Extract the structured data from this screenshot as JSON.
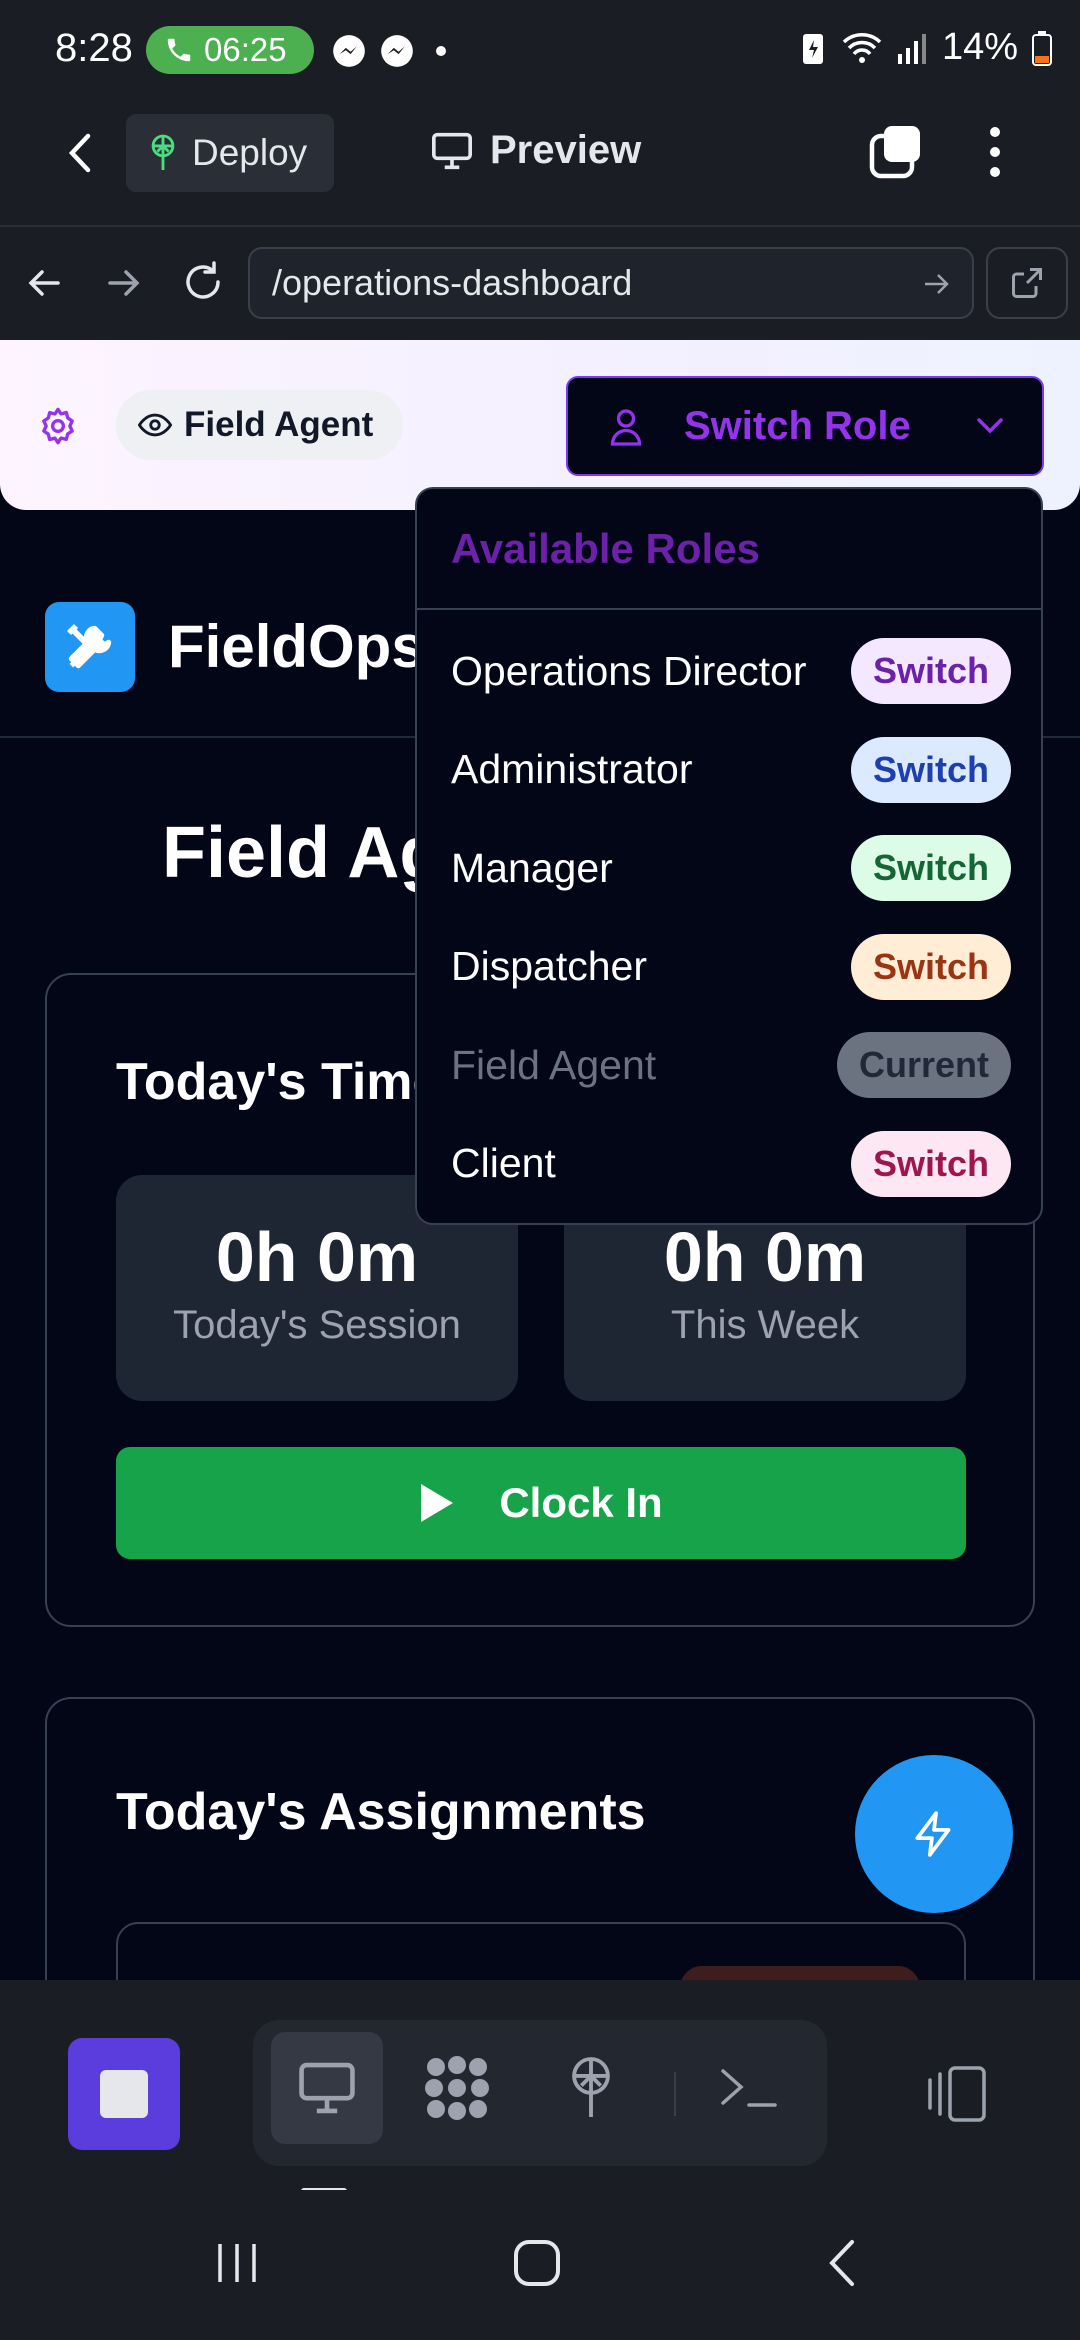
{
  "status_bar": {
    "time": "8:28",
    "call_timer": "06:25",
    "battery": "14%"
  },
  "app_header": {
    "deploy_label": "Deploy",
    "preview_label": "Preview"
  },
  "url_bar": {
    "url": "/operations-dashboard"
  },
  "role_banner": {
    "current_role": "Field Agent",
    "switch_label": "Switch Role"
  },
  "brand": {
    "name": "FieldOps"
  },
  "page": {
    "title": "Field Agent Dashboard"
  },
  "time_card": {
    "title": "Today's Time Tracking",
    "session_value": "0h 0m",
    "session_label": "Today's Session",
    "week_value": "0h 0m",
    "week_label": "This Week",
    "clock_in_label": "Clock In"
  },
  "assignments_card": {
    "title": "Today's Assignments"
  },
  "dropdown": {
    "header": "Available Roles",
    "roles": [
      {
        "name": "Operations Director",
        "badge": "Switch",
        "badge_bg": "#f3e8ff",
        "badge_fg": "#6b21a8"
      },
      {
        "name": "Administrator",
        "badge": "Switch",
        "badge_bg": "#dbeafe",
        "badge_fg": "#1e40af"
      },
      {
        "name": "Manager",
        "badge": "Switch",
        "badge_bg": "#dcfce7",
        "badge_fg": "#166534"
      },
      {
        "name": "Dispatcher",
        "badge": "Switch",
        "badge_bg": "#ffedd5",
        "badge_fg": "#9a3412"
      },
      {
        "name": "Field Agent",
        "badge": "Current",
        "badge_bg": "#6b7280",
        "badge_fg": "#1f2937"
      },
      {
        "name": "Client",
        "badge": "Switch",
        "badge_bg": "#fce7f3",
        "badge_fg": "#9d174d"
      }
    ]
  },
  "colors": {
    "accent_purple": "#9333ea",
    "clock_green": "#16a34a",
    "brand_blue": "#2196f3"
  }
}
